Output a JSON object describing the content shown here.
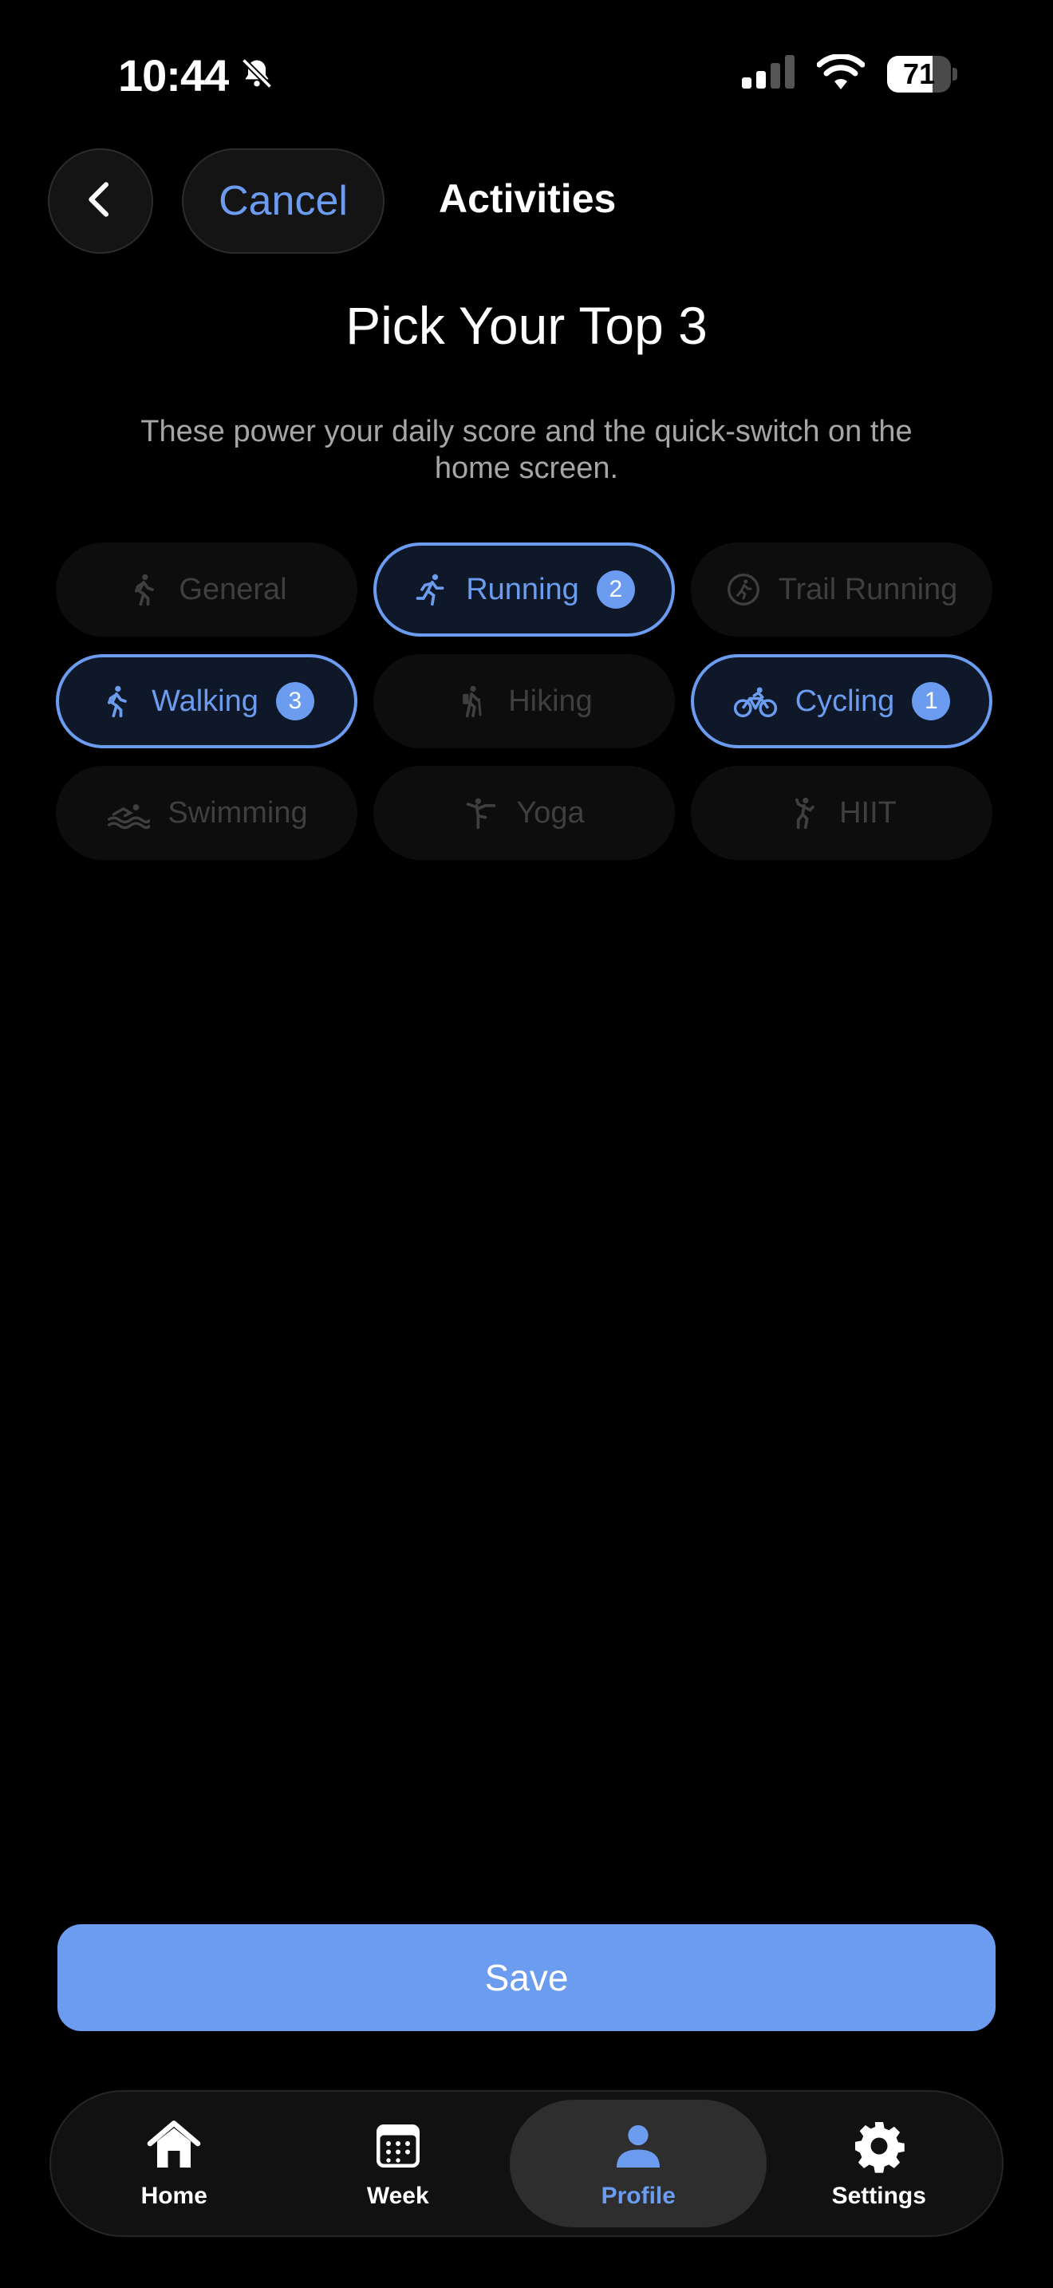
{
  "status_bar": {
    "time": "10:44",
    "battery": "71",
    "battery_level": 0.71
  },
  "header": {
    "cancel_label": "Cancel",
    "title": "Activities"
  },
  "page": {
    "title": "Pick Your Top 3",
    "subtitle": "These power your daily score and the quick-switch on the home screen."
  },
  "activities": [
    {
      "label": "General",
      "icon": "walking-figure-icon",
      "selected": false,
      "rank": ""
    },
    {
      "label": "Running",
      "icon": "running-figure-icon",
      "selected": true,
      "rank": "2"
    },
    {
      "label": "Trail Running",
      "icon": "trail-running-icon",
      "selected": false,
      "rank": ""
    },
    {
      "label": "Walking",
      "icon": "walking-figure-icon",
      "selected": true,
      "rank": "3"
    },
    {
      "label": "Hiking",
      "icon": "hiking-figure-icon",
      "selected": false,
      "rank": ""
    },
    {
      "label": "Cycling",
      "icon": "bicycle-icon",
      "selected": true,
      "rank": "1"
    },
    {
      "label": "Swimming",
      "icon": "swimming-icon",
      "selected": false,
      "rank": ""
    },
    {
      "label": "Yoga",
      "icon": "yoga-figure-icon",
      "selected": false,
      "rank": ""
    },
    {
      "label": "HIIT",
      "icon": "hiit-figure-icon",
      "selected": false,
      "rank": ""
    }
  ],
  "save_label": "Save",
  "tabs": [
    {
      "label": "Home",
      "icon": "house-icon",
      "active": false
    },
    {
      "label": "Week",
      "icon": "calendar-icon",
      "active": false
    },
    {
      "label": "Profile",
      "icon": "person-icon",
      "active": true
    },
    {
      "label": "Settings",
      "icon": "gear-icon",
      "active": false
    }
  ],
  "colors": {
    "accent": "#6b9cf0",
    "background": "#000000",
    "chip_inactive": "#0d0d0d",
    "chip_selected_bg": "#0f1828",
    "muted_text": "#a6a6a6"
  }
}
